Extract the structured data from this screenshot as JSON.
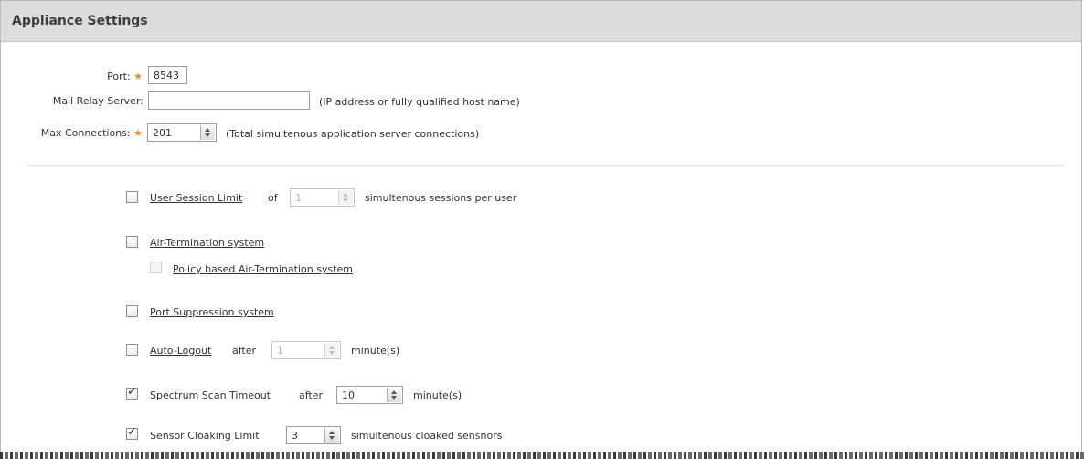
{
  "header": {
    "title": "Appliance Settings"
  },
  "fields": {
    "port": {
      "label": "Port:",
      "value": "8543",
      "required": "★"
    },
    "mail_relay": {
      "label": "Mail Relay Server:",
      "value": "",
      "hint": "(IP address or fully qualified host name)"
    },
    "max_connections": {
      "label": "Max Connections:",
      "value": "201",
      "required": "★",
      "hint": "(Total simultenous application server connections)"
    }
  },
  "options": {
    "user_session_limit": {
      "label": "User Session Limit",
      "checked": false,
      "pre": "of",
      "value": "1",
      "post": "simultenous sessions per user"
    },
    "air_termination": {
      "label": "Air-Termination system",
      "checked": false
    },
    "policy_air_termination": {
      "label": "Policy based Air-Termination system",
      "checked": false,
      "disabled": true
    },
    "port_suppression": {
      "label": "Port Suppression system",
      "checked": false
    },
    "auto_logout": {
      "label": "Auto-Logout",
      "checked": false,
      "pre": "after",
      "value": "1",
      "post": "minute(s)"
    },
    "spectrum_scan": {
      "label": "Spectrum Scan Timeout",
      "checked": true,
      "pre": "after",
      "value": "10",
      "post": "minute(s)"
    },
    "sensor_cloaking": {
      "label": "Sensor Cloaking Limit",
      "checked": true,
      "value": "3",
      "post": "simultenous cloaked sensnors"
    }
  },
  "colors": {
    "header_bg": "#dcdcdc",
    "required_star": "#f0871e"
  },
  "icons": {
    "required": "required-star-icon",
    "spinner": "spinner-arrows-icon",
    "check": "checkmark-icon"
  }
}
